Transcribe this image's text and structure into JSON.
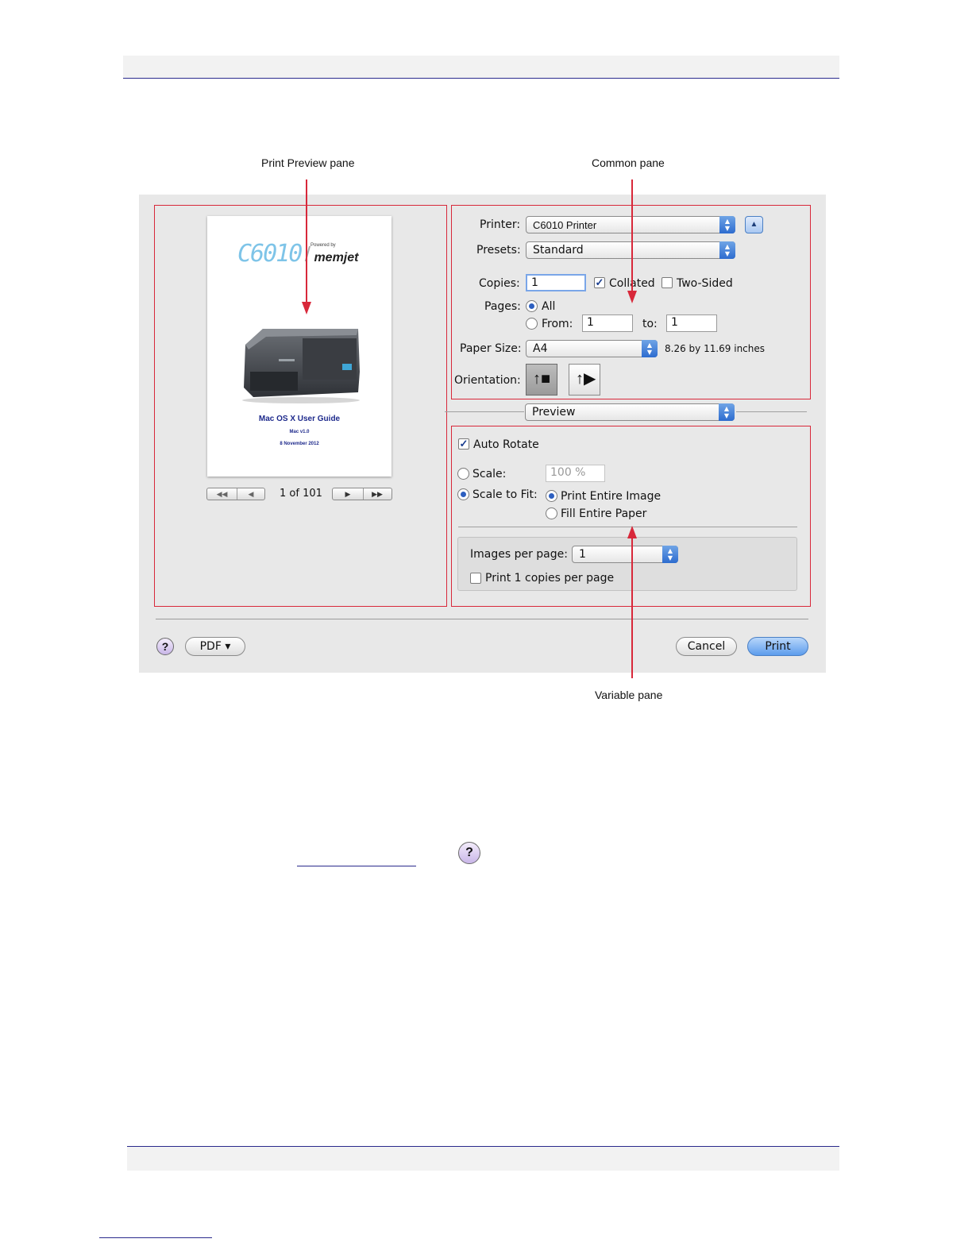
{
  "callouts": {
    "print_preview_pane": "Print Preview pane",
    "common_pane": "Common pane",
    "variable_pane": "Variable pane"
  },
  "preview": {
    "doc_logo_text": "C6010",
    "doc_brand": "memjet",
    "doc_brand_powered": "Powered by",
    "doc_title": "Mac OS X User Guide",
    "doc_version": "Mac v1.0",
    "doc_date": "8 November 2012",
    "page_counter": "1 of 101"
  },
  "common": {
    "printer_label": "Printer:",
    "printer_value": "C6010 Printer",
    "presets_label": "Presets:",
    "presets_value": "Standard",
    "copies_label": "Copies:",
    "copies_value": "1",
    "collated_label": "Collated",
    "two_sided_label": "Two-Sided",
    "pages_label": "Pages:",
    "pages_all": "All",
    "pages_from": "From:",
    "from_value": "1",
    "pages_to": "to:",
    "to_value": "1",
    "paper_size_label": "Paper Size:",
    "paper_size_value": "A4",
    "paper_dimensions": "8.26 by 11.69 inches",
    "orientation_label": "Orientation:"
  },
  "section_popup": "Preview",
  "variable": {
    "auto_rotate": "Auto Rotate",
    "scale_label": "Scale:",
    "scale_value": "100 %",
    "scale_to_fit": "Scale to Fit:",
    "print_entire_image": "Print Entire Image",
    "fill_entire_paper": "Fill Entire Paper",
    "images_per_page_label": "Images per page:",
    "images_per_page_value": "1",
    "print_copies_per_page": "Print 1 copies per page"
  },
  "footer": {
    "help": "?",
    "pdf": "PDF ▾",
    "cancel": "Cancel",
    "print": "Print"
  },
  "below": {
    "help_icon": "?"
  },
  "colors": {
    "annotation_red": "#d8283a",
    "rule_blue": "#2a2a8c",
    "accent_blue": "#2d6ccf"
  }
}
